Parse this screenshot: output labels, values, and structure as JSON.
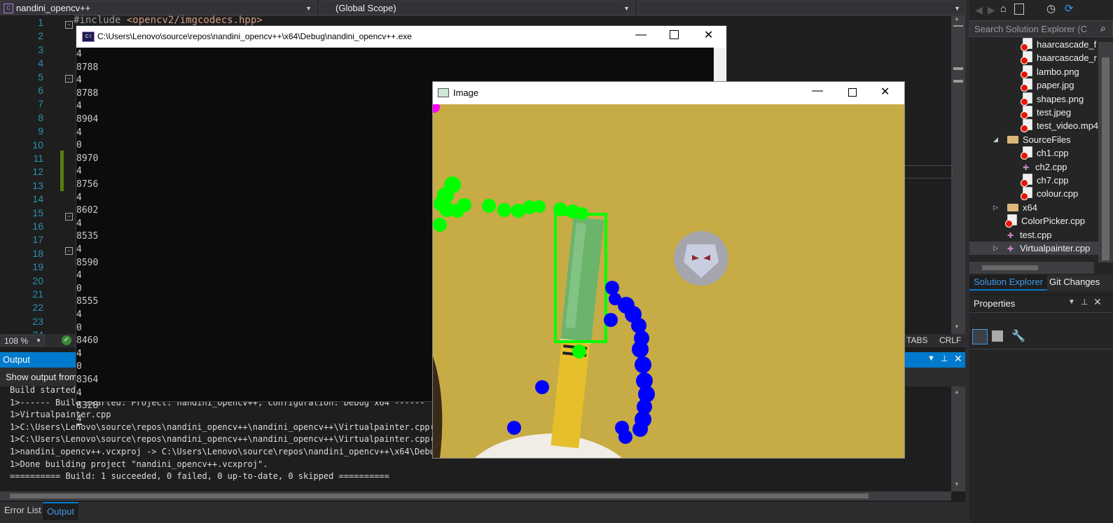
{
  "nav": {
    "project_dropdown": "nandini_opencv++",
    "scope_dropdown": "(Global Scope)"
  },
  "editor": {
    "line_numbers": [
      "1",
      "2",
      "3",
      "4",
      "5",
      "6",
      "7",
      "8",
      "9",
      "10",
      "11",
      "12",
      "13",
      "14",
      "15",
      "16",
      "17",
      "18",
      "19",
      "20",
      "21",
      "22",
      "23",
      "24"
    ],
    "first_line_prefix": "#include ",
    "first_line_include": "<opencv2/imgcodecs.hpp>",
    "zoom": "108 %",
    "tabs_label": "TABS",
    "crlf_label": "CRLF"
  },
  "console": {
    "title": "C:\\Users\\Lenovo\\source\\repos\\nandini_opencv++\\x64\\Debug\\nandini_opencv++.exe",
    "lines": [
      "4",
      "8788",
      "4",
      "8788",
      "4",
      "8904",
      "4",
      "0",
      "8970",
      "4",
      "8756",
      "4",
      "8602",
      "4",
      "8535",
      "4",
      "8590",
      "4",
      "0",
      "8555",
      "4",
      "0",
      "8460",
      "4",
      "0",
      "8364",
      "4",
      "8328",
      "4"
    ]
  },
  "image_window": {
    "title": "Image"
  },
  "output": {
    "header": "Output",
    "show_output_from": "Show output from",
    "lines": [
      "Build started...",
      "1>------ Build started: Project: nandini_opencv++, Configuration: Debug x64 ------",
      "1>Virtualpainter.cpp",
      "1>C:\\Users\\Lenovo\\source\\repos\\nandini_opencv++\\nandini_opencv++\\Virtualpainter.cpp(33,1",
      "1>C:\\Users\\Lenovo\\source\\repos\\nandini_opencv++\\nandini_opencv++\\Virtualpainter.cpp(39,1",
      "1>nandini_opencv++.vcxproj -> C:\\Users\\Lenovo\\source\\repos\\nandini_opencv++\\x64\\Debug\\na",
      "1>Done building project \"nandini_opencv++.vcxproj\".",
      "========== Build: 1 succeeded, 0 failed, 0 up-to-date, 0 skipped =========="
    ]
  },
  "bottom_tabs": {
    "error_list": "Error List",
    "output": "Output"
  },
  "solution_explorer": {
    "search_placeholder": "Search Solution Explorer (C",
    "items": [
      {
        "label": "haarcascade_f",
        "type": "file"
      },
      {
        "label": "haarcascade_r",
        "type": "file"
      },
      {
        "label": "lambo.png",
        "type": "file"
      },
      {
        "label": "paper.jpg",
        "type": "file"
      },
      {
        "label": "shapes.png",
        "type": "file"
      },
      {
        "label": "test.jpeg",
        "type": "file"
      },
      {
        "label": "test_video.mp4",
        "type": "file"
      },
      {
        "label": "SourceFiles",
        "type": "folder-open"
      },
      {
        "label": "ch1.cpp",
        "type": "file"
      },
      {
        "label": "ch2.cpp",
        "type": "cpp"
      },
      {
        "label": "ch7.cpp",
        "type": "file"
      },
      {
        "label": "colour.cpp",
        "type": "file"
      },
      {
        "label": "x64",
        "type": "folder"
      },
      {
        "label": "ColorPicker.cpp",
        "type": "file"
      },
      {
        "label": "test.cpp",
        "type": "cpp"
      },
      {
        "label": "Virtualpainter.cpp",
        "type": "cpp-selected"
      }
    ],
    "tab_solution": "Solution Explorer",
    "tab_git": "Git Changes"
  },
  "properties": {
    "title": "Properties"
  },
  "colors": {
    "accent": "#007acc",
    "tracked_green": "#00ff00",
    "tracked_blue": "#0000ff",
    "background_yellow": "#c7ab45"
  }
}
